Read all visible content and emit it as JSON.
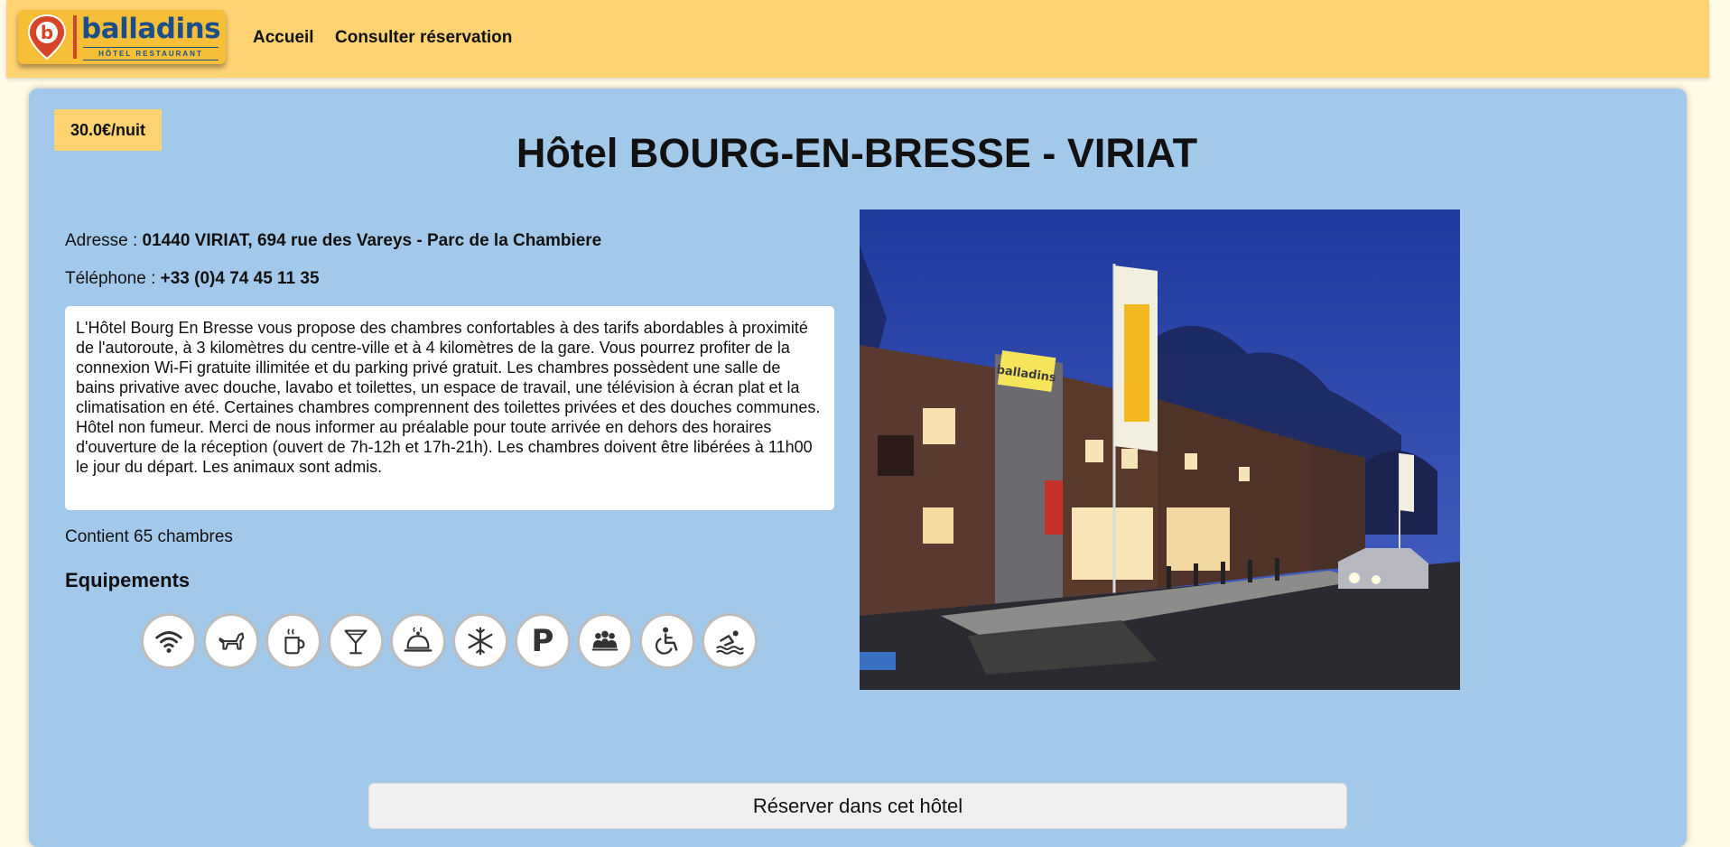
{
  "brand": {
    "logo_text": "balladins",
    "logo_tagline": "HÔTEL RESTAURANT",
    "logo_letter": "b",
    "color_brand_blue": "#1c4f8a",
    "color_brand_yellow": "#ffd272"
  },
  "nav": {
    "items": [
      {
        "label": "Accueil"
      },
      {
        "label": "Consulter réservation"
      }
    ]
  },
  "hotel": {
    "price": "30.0€/nuit",
    "title": "Hôtel BOURG-EN-BRESSE - VIRIAT",
    "address_label": "Adresse :",
    "address_value": "01440 VIRIAT, 694 rue des Vareys - Parc de la Chambiere",
    "phone_label": "Téléphone :",
    "phone_value": "+33 (0)4 74 45 11 35",
    "description": "L'Hôtel Bourg En Bresse vous propose des chambres confortables à des tarifs abordables à proximité de l'autoroute, à 3 kilomètres du centre-ville et à 4 kilomètres de la gare. Vous pourrez profiter de la connexion Wi-Fi gratuite illimitée et du parking privé gratuit. Les chambres possèdent une salle de bains privative avec douche, lavabo et toilettes, un espace de travail, une télévision à écran plat et la climatisation en été. Certaines chambres comprennent des toilettes privées et des douches communes. Hôtel non fumeur. Merci de nous informer au préalable pour toute arrivée en dehors des horaires d'ouverture de la réception (ouvert de 7h-12h et 17h-21h). Les chambres doivent être libérées à 11h00 le jour du départ. Les animaux sont admis.",
    "rooms": "Contient 65 chambres",
    "equipments_title": "Equipements",
    "equipments": [
      {
        "icon": "wifi-icon"
      },
      {
        "icon": "dog-icon"
      },
      {
        "icon": "coffee-cup-icon"
      },
      {
        "icon": "cocktail-icon"
      },
      {
        "icon": "room-service-icon"
      },
      {
        "icon": "snowflake-icon"
      },
      {
        "icon": "parking-icon",
        "glyph": "P"
      },
      {
        "icon": "group-icon"
      },
      {
        "icon": "wheelchair-icon"
      },
      {
        "icon": "swimmer-icon"
      }
    ],
    "photo_sign_text": "balladins",
    "book_button": "Réserver dans cet hôtel"
  },
  "colors": {
    "page_background": "#fffbe7",
    "card_background": "#a3c9ea",
    "header_background": "#ffd272"
  }
}
